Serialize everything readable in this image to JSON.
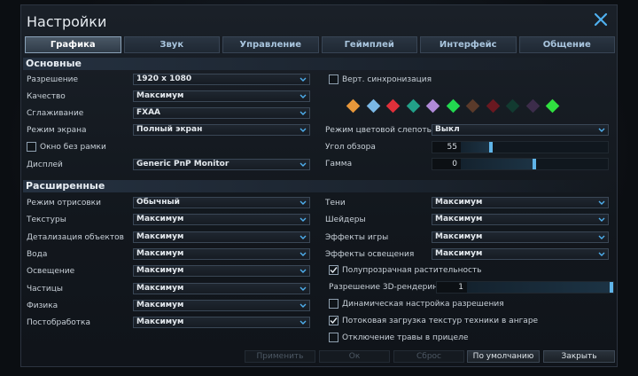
{
  "window": {
    "title": "Настройки"
  },
  "tabs": [
    "Графика",
    "Звук",
    "Управление",
    "Геймплей",
    "Интерфейс",
    "Общение"
  ],
  "active_tab": 0,
  "basic": {
    "heading": "Основные",
    "rows": [
      {
        "label": "Разрешение",
        "value": "1920 x 1080"
      },
      {
        "label": "Качество",
        "value": "Максимум"
      },
      {
        "label": "Сглаживание",
        "value": "FXAA"
      },
      {
        "label": "Режим экрана",
        "value": "Полный экран"
      }
    ],
    "borderless": {
      "label": "Окно без рамки",
      "checked": false
    },
    "display": {
      "label": "Дисплей",
      "value": "Generic PnP Monitor"
    },
    "vsync": {
      "label": "Верт. синхронизация",
      "checked": false
    },
    "colors": [
      "#e8973a",
      "#7ab8e6",
      "#e0303a",
      "#22a088",
      "#b08ad8",
      "#22d850",
      "#5a3a2a",
      "#6a1820",
      "#123a30",
      "#3c2c4a",
      "#30e040"
    ],
    "colorblind": {
      "label": "Режим цветовой слепоты",
      "value": "Выкл"
    },
    "fov": {
      "label": "Угол обзора",
      "value": "55",
      "fraction": 0.2
    },
    "gamma": {
      "label": "Гамма",
      "value": "0",
      "fraction": 0.5
    }
  },
  "advanced": {
    "heading": "Расширенные",
    "left": [
      {
        "label": "Режим отрисовки",
        "value": "Обычный"
      },
      {
        "label": "Текстуры",
        "value": "Максимум"
      },
      {
        "label": "Детализация объектов",
        "value": "Максимум"
      },
      {
        "label": "Вода",
        "value": "Максимум"
      },
      {
        "label": "Освещение",
        "value": "Максимум"
      },
      {
        "label": "Частицы",
        "value": "Максимум"
      },
      {
        "label": "Физика",
        "value": "Максимум"
      },
      {
        "label": "Постобработка",
        "value": "Максимум"
      }
    ],
    "right": [
      {
        "label": "Тени",
        "value": "Максимум"
      },
      {
        "label": "Шейдеры",
        "value": "Максимум"
      },
      {
        "label": "Эффекты игры",
        "value": "Максимум"
      },
      {
        "label": "Эффекты освещения",
        "value": "Максимум"
      }
    ],
    "translucent_foliage": {
      "label": "Полупрозрачная растительность",
      "checked": true
    },
    "render_3d": {
      "label": "Разрешение 3D-рендеринга",
      "value": "1",
      "fraction": 1.0
    },
    "dynamic_res": {
      "label": "Динамическая настройка разрешения",
      "checked": false
    },
    "streaming": {
      "label": "Потоковая загрузка текстур техники в ангаре",
      "checked": true
    },
    "grass_off": {
      "label": "Отключение травы в прицеле",
      "checked": false
    }
  },
  "footer": {
    "apply": "Применить",
    "ok": "Ок",
    "reset": "Сброс",
    "defaults": "По умолчанию",
    "close": "Закрыть"
  }
}
